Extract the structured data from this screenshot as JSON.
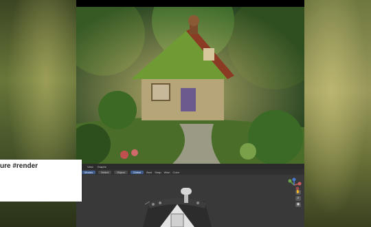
{
  "caption": {
    "text": "ure #render"
  },
  "editor": {
    "header_menu": [
      "View",
      "Graphs"
    ],
    "toolbar": {
      "pills": [
        "Modes",
        "Select",
        "Object",
        "Global"
      ],
      "menus": [
        "Bool",
        "Snap",
        "Wwn",
        "Color"
      ]
    },
    "nav_icons": [
      "hand-icon",
      "zoom-icon",
      "camera-icon"
    ]
  },
  "colors": {
    "accent": "#3f5d8f",
    "viewport_bg": "#393939",
    "caption_bg": "#ffffff"
  }
}
